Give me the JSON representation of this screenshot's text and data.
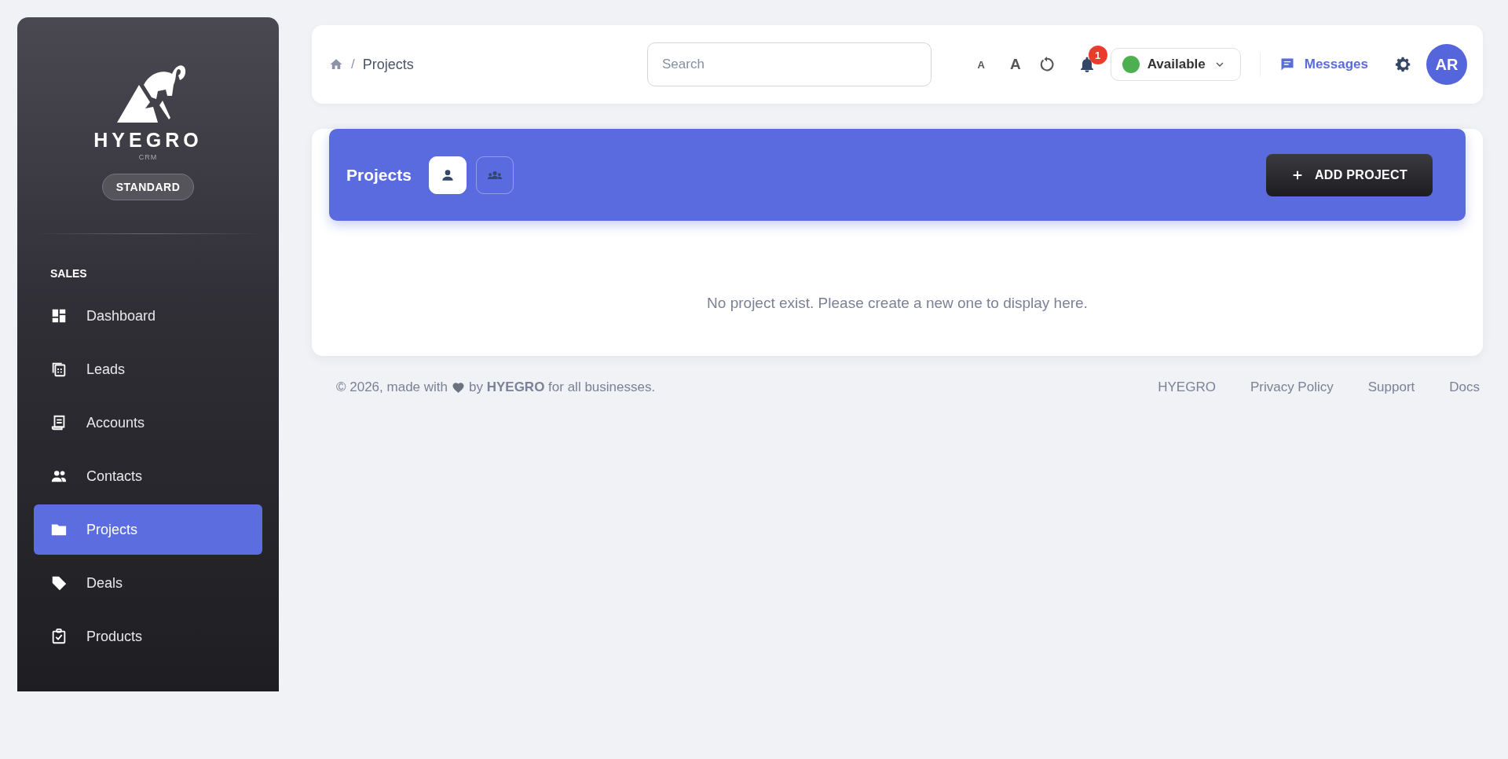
{
  "sidebar": {
    "brand": "HYEGRO",
    "brand_sub": "CRM",
    "plan": "STANDARD",
    "section": "SALES",
    "items": [
      {
        "label": "Dashboard",
        "selected": false
      },
      {
        "label": "Leads",
        "selected": false
      },
      {
        "label": "Accounts",
        "selected": false
      },
      {
        "label": "Contacts",
        "selected": false
      },
      {
        "label": "Projects",
        "selected": true
      },
      {
        "label": "Deals",
        "selected": false
      },
      {
        "label": "Products",
        "selected": false
      }
    ]
  },
  "topbar": {
    "separator": "/",
    "breadcrumb": "Projects",
    "search": {
      "placeholder": "Search"
    },
    "font_small": "A",
    "font_large": "A",
    "notifications": "1",
    "status": {
      "label": "Available",
      "color": "#4caf50"
    },
    "messages": "Messages",
    "avatar": "AR"
  },
  "projects": {
    "title": "Projects",
    "views": [
      {
        "kind": "person",
        "selected": true
      },
      {
        "kind": "group",
        "selected": false
      }
    ],
    "add_button": "ADD PROJECT",
    "empty": "No project exist. Please create a new one to display here."
  },
  "footer": {
    "made_with": "© 2026, made with",
    "by_line": "by **HYEGRO** for all businesses.",
    "links": [
      "HYEGRO",
      "Privacy Policy",
      "Support",
      "Docs"
    ]
  }
}
